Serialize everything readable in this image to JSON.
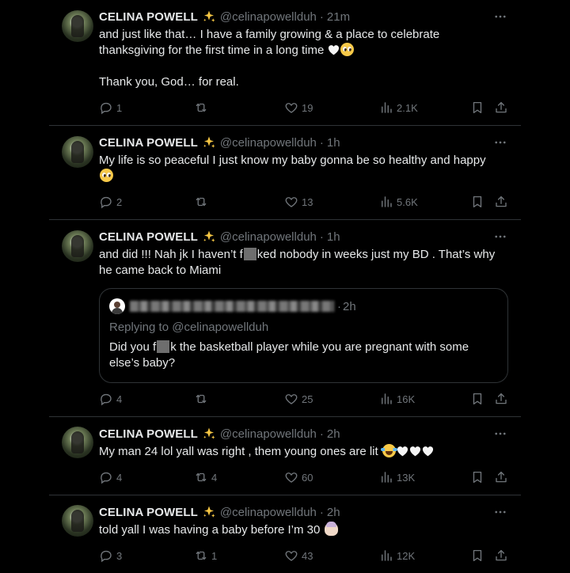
{
  "tweets": [
    {
      "name": "CELINA POWELL",
      "handle": "@celinapowellduh",
      "time": "21m",
      "text_line1": "and just like that… I have a family growing & a place to celebrate",
      "text_line2": "thanksgiving for the first time in a long time",
      "text_line3": "Thank you, God… for real.",
      "replies": "1",
      "retweets": "",
      "likes": "19",
      "views": "2.1K"
    },
    {
      "name": "CELINA POWELL",
      "handle": "@celinapowellduh",
      "time": "1h",
      "text_line1": "My life is so peaceful I just know my baby gonna be so healthy and happy",
      "replies": "2",
      "retweets": "",
      "likes": "13",
      "views": "5.6K"
    },
    {
      "name": "CELINA POWELL",
      "handle": "@celinapowellduh",
      "time": "1h",
      "text_pre": "and did !!! Nah jk I haven’t f",
      "text_post": "ked nobody in weeks just my BD . That’s why",
      "text_line2": "he came back to Miami",
      "quote": {
        "time": "2h",
        "replying_to": "Replying to @celinapowellduh",
        "text_pre": "Did you f",
        "text_post": "k the basketball player while you are pregnant with some",
        "text_line2": "else’s baby?"
      },
      "replies": "4",
      "retweets": "",
      "likes": "25",
      "views": "16K"
    },
    {
      "name": "CELINA POWELL",
      "handle": "@celinapowellduh",
      "time": "2h",
      "text_line1": "My man 24 lol yall was right , them young ones are lit",
      "replies": "4",
      "retweets": "4",
      "likes": "60",
      "views": "13K"
    },
    {
      "name": "CELINA POWELL",
      "handle": "@celinapowellduh",
      "time": "2h",
      "text_line1": "told yall I was having a baby before I’m 30",
      "replies": "3",
      "retweets": "1",
      "likes": "43",
      "views": "12K"
    }
  ],
  "icons": {
    "verified": "sparkles-icon",
    "more": "more-icon",
    "reply": "reply-icon",
    "retweet": "retweet-icon",
    "like": "heart-icon",
    "views": "views-icon",
    "bookmark": "bookmark-icon",
    "share": "share-icon"
  },
  "colors": {
    "background": "#000000",
    "text": "#e7e9ea",
    "muted": "#71767b",
    "border": "#2f3336"
  }
}
